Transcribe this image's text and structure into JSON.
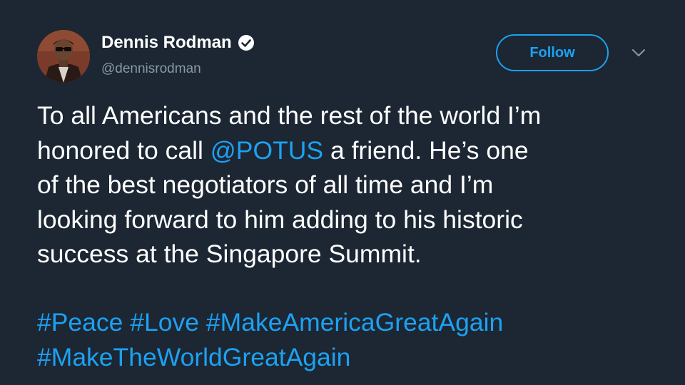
{
  "user": {
    "display_name": "Dennis Rodman",
    "handle": "@dennisrodman",
    "verified": true
  },
  "actions": {
    "follow_label": "Follow"
  },
  "tweet": {
    "line1": "To all Americans and the rest of the world I’m",
    "line2_before": "honored to call ",
    "line2_mention": "@POTUS",
    "line2_after": " a friend. He’s one",
    "line3": "of the best negotiators of all time and I’m",
    "line4": "looking forward to him adding to his historic",
    "line5": "success at the Singapore Summit.",
    "hashtags": [
      "#Peace",
      "#Love",
      "#MakeAmericaGreatAgain",
      "#MakeTheWorldGreatAgain"
    ]
  },
  "colors": {
    "background": "#1c2733",
    "accent": "#1da1f2",
    "text": "#ffffff",
    "muted": "#8899a6"
  },
  "icons": {
    "verified": "verified-badge-icon",
    "caret": "chevron-down-icon"
  }
}
